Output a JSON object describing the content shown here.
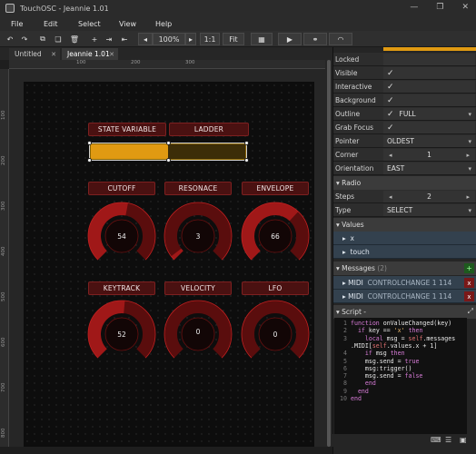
{
  "window": {
    "title": "TouchOSC - Jeannie 1.01",
    "controls": [
      "—",
      "❐",
      "✕"
    ]
  },
  "menu": [
    "File",
    "Edit",
    "Select",
    "View",
    "Help"
  ],
  "toolbar": {
    "zoom": "100%",
    "ratio": "1:1",
    "fit": "Fit"
  },
  "tabs": [
    {
      "label": "Untitled"
    },
    {
      "label": "Jeannie 1.01"
    }
  ],
  "ruler": {
    "h": [
      "100",
      "200",
      "300"
    ],
    "v": [
      "100",
      "200",
      "300",
      "400",
      "500",
      "600",
      "700",
      "800"
    ]
  },
  "canvas": {
    "labels": [
      "STATE VARIABLE",
      "LADDER",
      "CUTOFF",
      "RESONACE",
      "ENVELOPE",
      "KEYTRACK",
      "VELOCITY",
      "LFO"
    ],
    "fader_value": 0.5,
    "knobs": [
      {
        "value": "54",
        "level": 0.54
      },
      {
        "value": "3",
        "level": 0.03
      },
      {
        "value": "66",
        "level": 0.66
      },
      {
        "value": "52",
        "level": 0.52
      },
      {
        "value": "0",
        "level": 0.0
      },
      {
        "value": "0",
        "level": 0.0
      }
    ],
    "colors": {
      "accent": "#e09a12",
      "knob_bg": "#5a0d0d",
      "knob_arc": "#a01818",
      "button_bg": "#4a1111"
    }
  },
  "props": {
    "locked": "Locked",
    "visible": "Visible",
    "interactive": "Interactive",
    "background": "Background",
    "outline": {
      "label": "Outline",
      "value": "FULL"
    },
    "grab_focus": "Grab Focus",
    "pointer": {
      "label": "Pointer",
      "value": "OLDEST"
    },
    "corner": {
      "label": "Corner",
      "value": "1"
    },
    "orientation": {
      "label": "Orientation",
      "value": "EAST"
    }
  },
  "radio": {
    "header": "Radio",
    "steps_label": "Steps",
    "steps_value": "2",
    "type_label": "Type",
    "type_value": "SELECT"
  },
  "values": {
    "header": "Values",
    "items": [
      "x",
      "touch"
    ]
  },
  "messages": {
    "header": "Messages",
    "count": "(2)",
    "items": [
      {
        "kind": "MIDI",
        "detail": "CONTROLCHANGE 1 114"
      },
      {
        "kind": "MIDI",
        "detail": "CONTROLCHANGE 1 114"
      }
    ]
  },
  "script": {
    "header": "Script",
    "line_numbers": [
      "1",
      "2",
      "3",
      "4",
      "5",
      "6",
      "7",
      "8",
      "9",
      "10"
    ],
    "lines": [
      "function onValueChanged(key)",
      "  if key == 'x' then",
      "    local msg = self.messages",
      ".MIDI[self.values.x + 1]",
      "    if msg then",
      "    msg.send = true",
      "    msg:trigger()",
      "    msg.send = false",
      "    end",
      "  end",
      "end"
    ]
  }
}
